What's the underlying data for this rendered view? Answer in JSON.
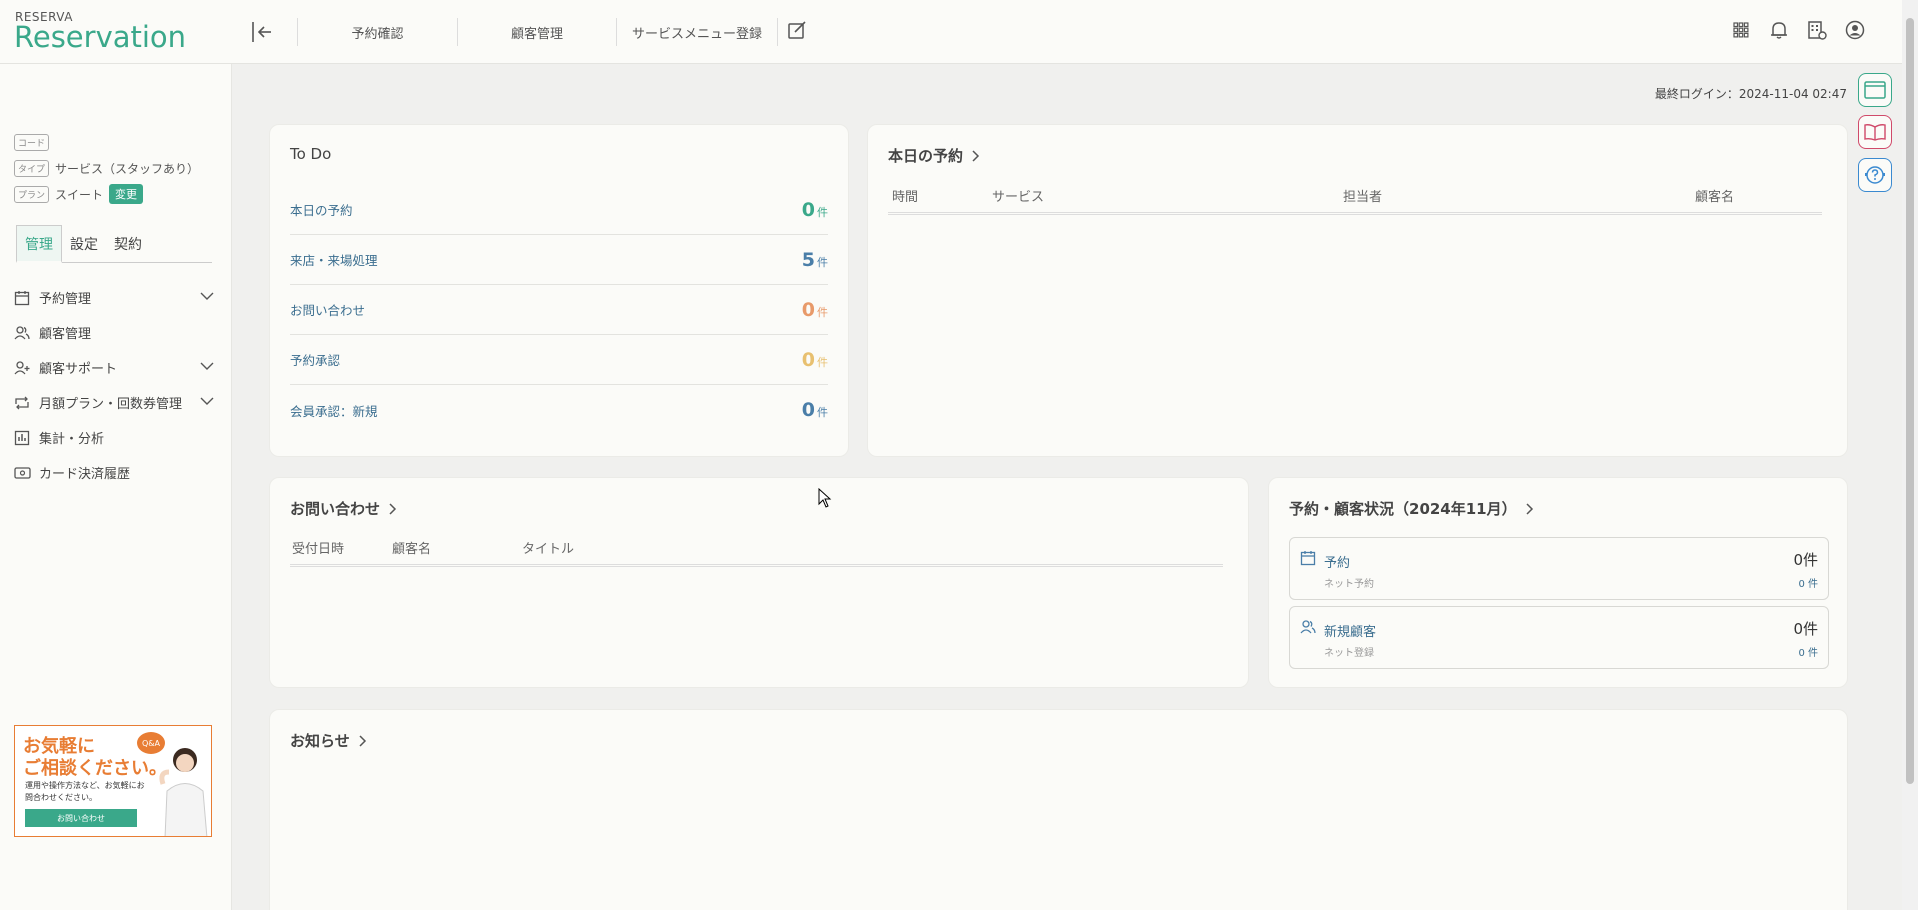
{
  "app": {
    "brand_small": "RESERVA",
    "brand_big": "Reservation"
  },
  "topnav": {
    "items": [
      {
        "label": "予約確認"
      },
      {
        "label": "顧客管理"
      },
      {
        "label": "サービスメニュー登録"
      }
    ]
  },
  "top_icons": [
    "grid-icon",
    "bell-icon",
    "building-settings-icon",
    "user-circle-icon"
  ],
  "sidebar": {
    "meta": {
      "code_tag": "コード",
      "code_value": "",
      "type_tag": "タイプ",
      "type_value": "サービス（スタッフあり）",
      "plan_tag": "プラン",
      "plan_value": "スイート",
      "change_label": "変更"
    },
    "tabs": [
      {
        "label": "管理",
        "active": true
      },
      {
        "label": "設定",
        "active": false
      },
      {
        "label": "契約",
        "active": false
      }
    ],
    "menu": [
      {
        "label": "予約管理",
        "icon": "calendar-icon",
        "expandable": true
      },
      {
        "label": "顧客管理",
        "icon": "users-icon",
        "expandable": false
      },
      {
        "label": "顧客サポート",
        "icon": "user-plus-icon",
        "expandable": true
      },
      {
        "label": "月額プラン・回数券管理",
        "icon": "repeat-icon",
        "expandable": true
      },
      {
        "label": "集計・分析",
        "icon": "bar-chart-icon",
        "expandable": false
      },
      {
        "label": "カード決済履歴",
        "icon": "card-icon",
        "expandable": false
      }
    ],
    "ad": {
      "line1": "お気軽に",
      "line2": "ご相談ください。",
      "sub": "運用や操作方法など、お気軽にお問合わせください。",
      "button": "お問い合わせ",
      "badge": "Q&A"
    }
  },
  "main": {
    "last_login": "最終ログイン：2024-11-04 02:47",
    "todo": {
      "title": "To Do",
      "unit": "件",
      "rows": [
        {
          "label": "本日の予約",
          "count": "0",
          "color": "#3aa88a"
        },
        {
          "label": "来店・来場処理",
          "count": "5",
          "color": "#4a7ea8"
        },
        {
          "label": "お問い合わせ",
          "count": "0",
          "color": "#e89a6a"
        },
        {
          "label": "予約承認",
          "count": "0",
          "color": "#e8c070"
        },
        {
          "label": "会員承認：新規",
          "count": "0",
          "color": "#4a7ea8"
        }
      ]
    },
    "today": {
      "title": "本日の予約",
      "columns": [
        "時間",
        "サービス",
        "担当者",
        "顧客名"
      ]
    },
    "inquiries": {
      "title": "お問い合わせ",
      "columns": [
        "受付日時",
        "顧客名",
        "タイトル"
      ]
    },
    "status": {
      "title": "予約・顧客状況（2024年11月）",
      "items": [
        {
          "label": "予約",
          "sub": "ネット予約",
          "value": "0件",
          "sub_value": "0 件",
          "icon": "calendar-icon"
        },
        {
          "label": "新規顧客",
          "sub": "ネット登録",
          "value": "0件",
          "sub_value": "0 件",
          "icon": "users-icon"
        }
      ]
    },
    "news": {
      "title": "お知らせ"
    }
  },
  "colors": {
    "accent": "#3aa88a",
    "link": "#3b6e8f",
    "ad": "#e87d34"
  }
}
